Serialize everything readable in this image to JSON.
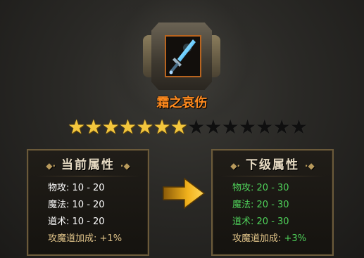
{
  "item": {
    "name": "霜之哀伤",
    "icon": "frost-sword-icon",
    "slot_border_color": "#b8641f",
    "name_color": "#ff8a1e"
  },
  "stars": {
    "lit": 7,
    "total": 14,
    "lit_color": "#f3c63d"
  },
  "current": {
    "title": "当前属性",
    "stats": [
      {
        "label": "物攻:",
        "value": "10 - 20"
      },
      {
        "label": "魔法:",
        "value": "10 - 20"
      },
      {
        "label": "道术:",
        "value": "10 - 20"
      }
    ],
    "bonus_label": "攻魔道加成:",
    "bonus_value": "+1%"
  },
  "next": {
    "title": "下级属性",
    "stats": [
      {
        "label": "物攻:",
        "value": "20 - 30"
      },
      {
        "label": "魔法:",
        "value": "20 - 30"
      },
      {
        "label": "道术:",
        "value": "20 - 30"
      }
    ],
    "bonus_label": "攻魔道加成:",
    "bonus_value": "+3%",
    "highlight_color": "#4fd25a"
  },
  "arrow_icon": "upgrade-arrow-icon"
}
